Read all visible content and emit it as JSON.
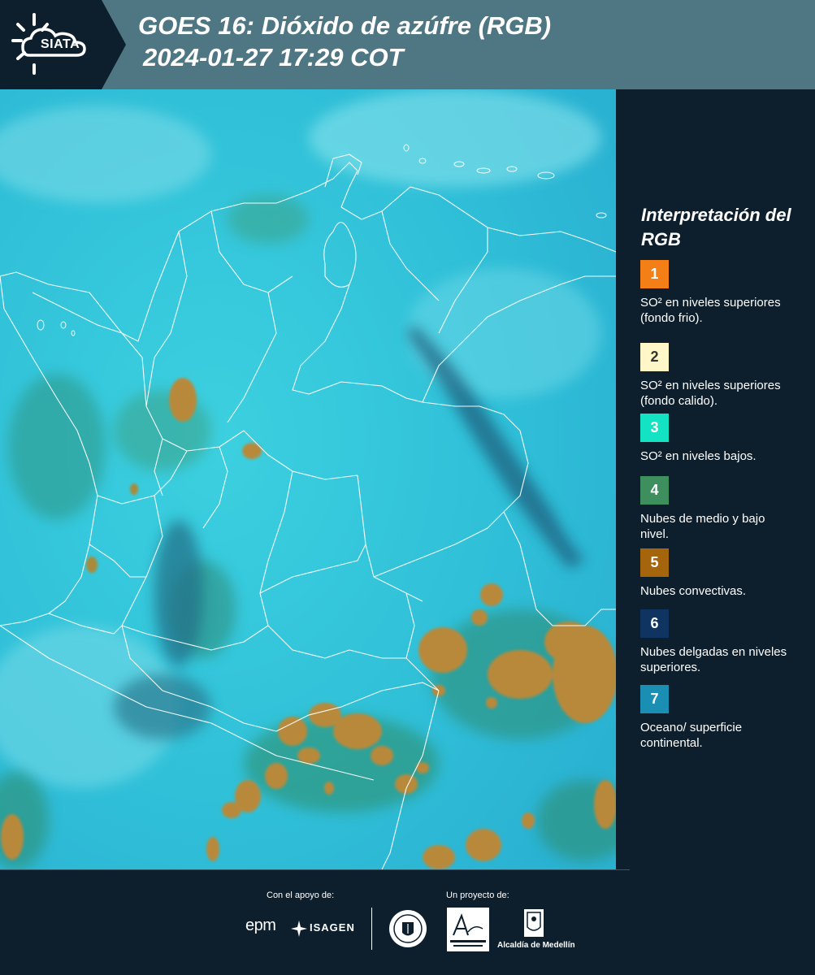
{
  "header": {
    "brand": "SIATA",
    "title_line1": "GOES 16: Dióxido de azúfre (RGB)",
    "title_line2": "2024-01-27 17:29 COT"
  },
  "colors": {
    "header_bg": "#4f7683",
    "panel_bg": "#0d1f2d",
    "map_base": "#33c6dc",
    "border_line": "#ffffff"
  },
  "legend": {
    "title": "Interpretación del RGB",
    "items": [
      {
        "number": "1",
        "label": "SO² en niveles superiores (fondo frio).",
        "color": "#f47f17",
        "text_color": "#ffffff"
      },
      {
        "number": "2",
        "label": "SO² en niveles superiores (fondo calido).",
        "color": "#fff7c7",
        "text_color": "#333333"
      },
      {
        "number": "3",
        "label": "SO² en niveles bajos.",
        "color": "#13e3c2",
        "text_color": "#ffffff"
      },
      {
        "number": "4",
        "label": "Nubes de medio y bajo nivel.",
        "color": "#3d8f5e",
        "text_color": "#ffffff"
      },
      {
        "number": "5",
        "label": "Nubes convectivas.",
        "color": "#a5650d",
        "text_color": "#ffffff"
      },
      {
        "number": "6",
        "label": "Nubes delgadas en niveles superiores.",
        "color": "#0f3461",
        "text_color": "#ffffff"
      },
      {
        "number": "7",
        "label": "Oceano/ superficie continental.",
        "color": "#1a8fb3",
        "text_color": "#ffffff"
      }
    ]
  },
  "footer": {
    "support_label": "Con el apoyo de:",
    "project_label": "Un proyecto de:",
    "sponsor_epm": "epm",
    "sponsor_isagen": "ISAGEN",
    "partner_alcaldia": "Alcaldía de Medellín"
  }
}
